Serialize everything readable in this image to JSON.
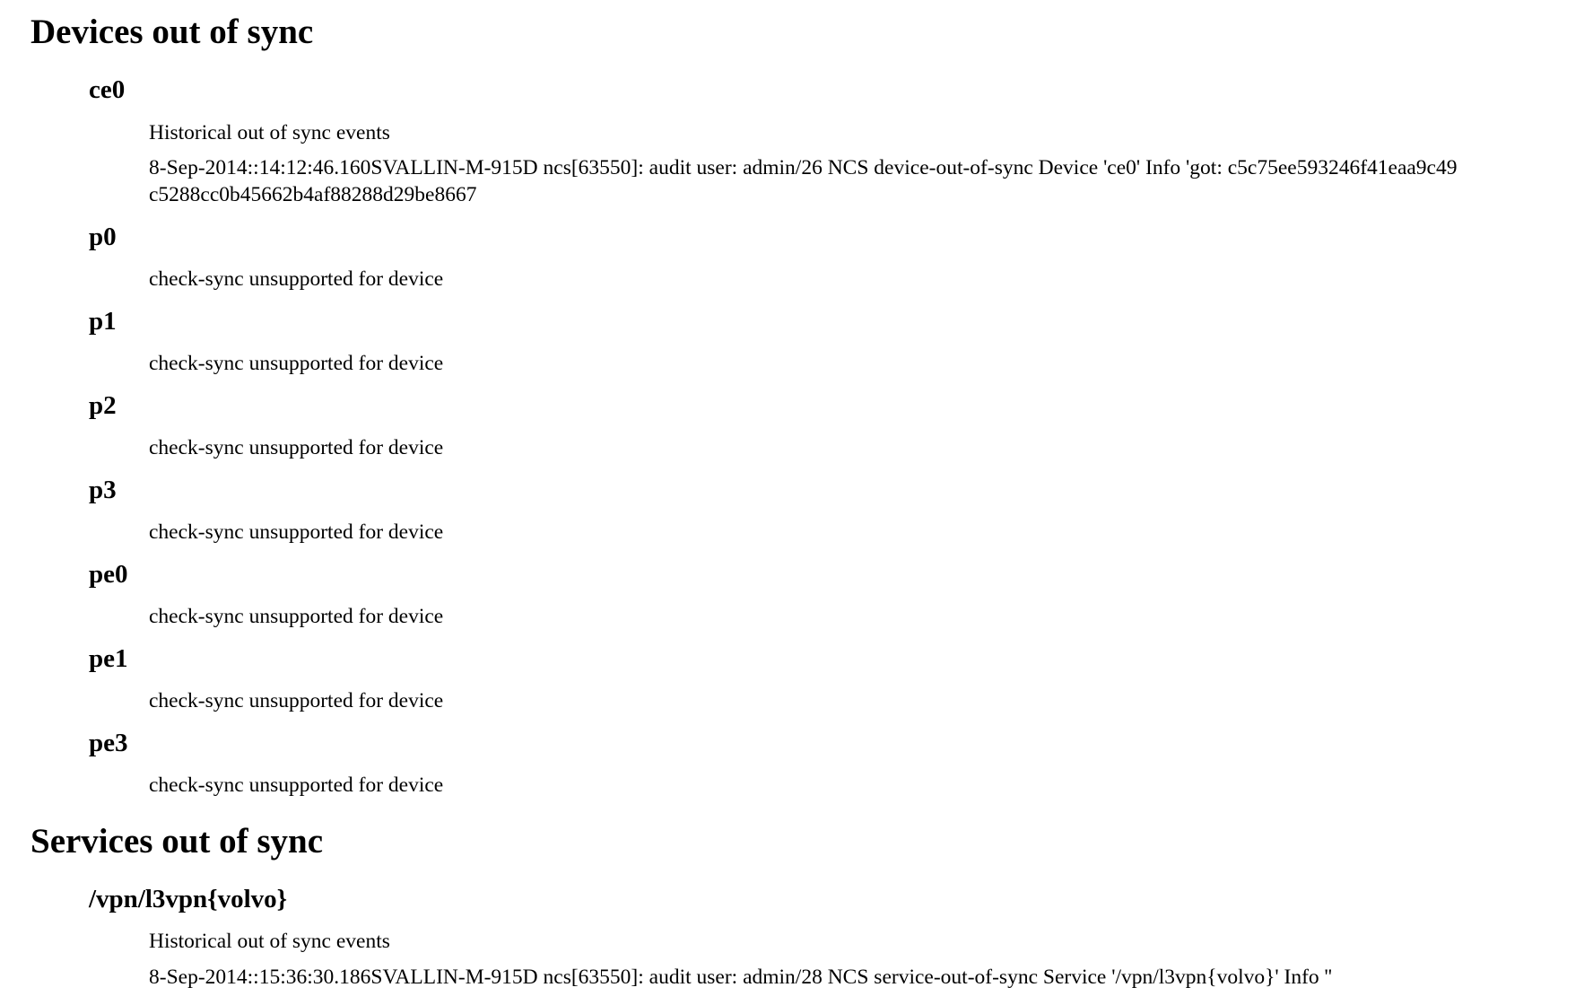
{
  "devices": {
    "heading": "Devices out of sync",
    "items": [
      {
        "name": "ce0",
        "label": "Historical out of sync events",
        "event_line1": "8-Sep-2014::14:12:46.160SVALLIN-M-915D ncs[63550]: audit user: admin/26 NCS device-out-of-sync Device 'ce0' Info 'got: c5c75ee593246f41eaa9c49",
        "event_line2": "c5288cc0b45662b4af88288d29be8667"
      },
      {
        "name": "p0",
        "message": "check-sync unsupported for device"
      },
      {
        "name": "p1",
        "message": "check-sync unsupported for device"
      },
      {
        "name": "p2",
        "message": "check-sync unsupported for device"
      },
      {
        "name": "p3",
        "message": "check-sync unsupported for device"
      },
      {
        "name": "pe0",
        "message": "check-sync unsupported for device"
      },
      {
        "name": "pe1",
        "message": "check-sync unsupported for device"
      },
      {
        "name": "pe3",
        "message": "check-sync unsupported for device"
      }
    ]
  },
  "services": {
    "heading": "Services out of sync",
    "items": [
      {
        "name": "/vpn/l3vpn{volvo}",
        "label": "Historical out of sync events",
        "event_line1": "8-Sep-2014::15:36:30.186SVALLIN-M-915D ncs[63550]: audit user: admin/28 NCS service-out-of-sync Service '/vpn/l3vpn{volvo}' Info ''"
      }
    ]
  }
}
